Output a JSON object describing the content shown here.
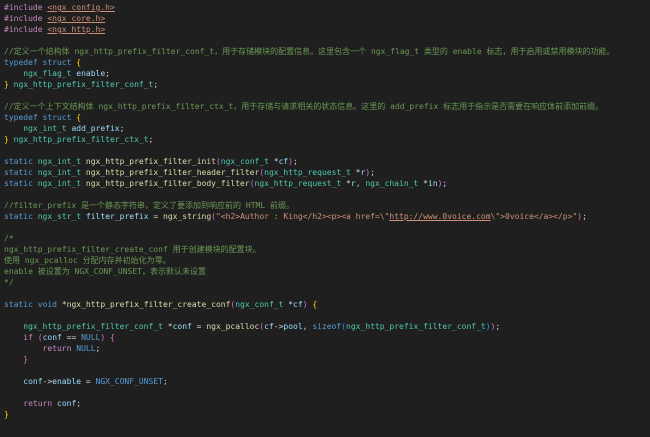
{
  "colors": {
    "background": "#1f1f1f",
    "plain": "#d4d4d4",
    "keyword": "#569cd6",
    "preprocessor": "#c586c0",
    "type": "#4ec9b0",
    "function": "#dcdcaa",
    "variable": "#9cdcfe",
    "string": "#ce9178",
    "comment": "#6a9955",
    "brace": "#ffd700"
  },
  "lines": [
    [
      {
        "t": "#include ",
        "c": "prep"
      },
      {
        "t": "<ngx_config.h>",
        "c": "inc"
      }
    ],
    [
      {
        "t": "#include ",
        "c": "prep"
      },
      {
        "t": "<ngx_core.h>",
        "c": "inc"
      }
    ],
    [
      {
        "t": "#include ",
        "c": "prep"
      },
      {
        "t": "<ngx_http.h>",
        "c": "inc"
      }
    ],
    [],
    [
      {
        "t": "//定义一个结构体 ngx_http_prefix_filter_conf_t，用于存储模块的配置信息。这里包含一个 ngx_flag_t 类型的 enable 标志，用于启用或禁用模块的功能。",
        "c": "comment"
      }
    ],
    [
      {
        "t": "typedef",
        "c": "kw"
      },
      {
        "t": " ",
        "c": "plain"
      },
      {
        "t": "struct",
        "c": "kw"
      },
      {
        "t": " ",
        "c": "plain"
      },
      {
        "t": "{",
        "c": "brace1"
      }
    ],
    [
      {
        "t": "    ",
        "c": "plain"
      },
      {
        "t": "ngx_flag_t",
        "c": "type",
        "s": 1
      },
      {
        "t": " ",
        "c": "plain"
      },
      {
        "t": "enable",
        "c": "var"
      },
      {
        "t": ";",
        "c": "plain"
      }
    ],
    [
      {
        "t": "}",
        "c": "brace1"
      },
      {
        "t": " ",
        "c": "plain"
      },
      {
        "t": "ngx_http_prefix_filter_conf_t",
        "c": "type"
      },
      {
        "t": ";",
        "c": "plain"
      }
    ],
    [],
    [
      {
        "t": "//定义一个上下文结构体 ngx_http_prefix_filter_ctx_t，用于存储与请求相关的状态信息。这里的 add_prefix 标志用于指示是否需要在响应体前添加前缀。",
        "c": "comment"
      }
    ],
    [
      {
        "t": "typedef",
        "c": "kw"
      },
      {
        "t": " ",
        "c": "plain"
      },
      {
        "t": "struct",
        "c": "kw"
      },
      {
        "t": " ",
        "c": "plain"
      },
      {
        "t": "{",
        "c": "brace1"
      }
    ],
    [
      {
        "t": "    ",
        "c": "plain"
      },
      {
        "t": "ngx_int_t",
        "c": "type",
        "s": 1
      },
      {
        "t": " ",
        "c": "plain"
      },
      {
        "t": "add_prefix",
        "c": "var"
      },
      {
        "t": ";",
        "c": "plain"
      }
    ],
    [
      {
        "t": "}",
        "c": "brace1"
      },
      {
        "t": " ",
        "c": "plain"
      },
      {
        "t": "ngx_http_prefix_filter_ctx_t",
        "c": "type"
      },
      {
        "t": ";",
        "c": "plain"
      }
    ],
    [],
    [
      {
        "t": "static",
        "c": "kw"
      },
      {
        "t": " ",
        "c": "plain"
      },
      {
        "t": "ngx_int_t",
        "c": "type",
        "s": 1
      },
      {
        "t": " ",
        "c": "plain"
      },
      {
        "t": "ngx_http_prefix_filter_init",
        "c": "func"
      },
      {
        "t": "(",
        "c": "brace2"
      },
      {
        "t": "ngx_conf_t",
        "c": "type",
        "s": 1
      },
      {
        "t": " *",
        "c": "plain"
      },
      {
        "t": "cf",
        "c": "var"
      },
      {
        "t": ")",
        "c": "brace2"
      },
      {
        "t": ";",
        "c": "plain"
      }
    ],
    [
      {
        "t": "static",
        "c": "kw"
      },
      {
        "t": " ",
        "c": "plain"
      },
      {
        "t": "ngx_int_t",
        "c": "type",
        "s": 1
      },
      {
        "t": " ",
        "c": "plain"
      },
      {
        "t": "ngx_http_prefix_filter_header_filter",
        "c": "func"
      },
      {
        "t": "(",
        "c": "brace2"
      },
      {
        "t": "ngx_http_request_t",
        "c": "type",
        "s": 1
      },
      {
        "t": " *",
        "c": "plain"
      },
      {
        "t": "r",
        "c": "var"
      },
      {
        "t": ")",
        "c": "brace2"
      },
      {
        "t": ";",
        "c": "plain"
      }
    ],
    [
      {
        "t": "static",
        "c": "kw"
      },
      {
        "t": " ",
        "c": "plain"
      },
      {
        "t": "ngx_int_t",
        "c": "type",
        "s": 1
      },
      {
        "t": " ",
        "c": "plain"
      },
      {
        "t": "ngx_http_prefix_filter_body_filter",
        "c": "func"
      },
      {
        "t": "(",
        "c": "brace2"
      },
      {
        "t": "ngx_http_request_t",
        "c": "type",
        "s": 1
      },
      {
        "t": " *",
        "c": "plain"
      },
      {
        "t": "r",
        "c": "var"
      },
      {
        "t": ", ",
        "c": "plain"
      },
      {
        "t": "ngx_chain_t",
        "c": "type",
        "s": 1
      },
      {
        "t": " *",
        "c": "plain"
      },
      {
        "t": "in",
        "c": "var"
      },
      {
        "t": ")",
        "c": "brace2"
      },
      {
        "t": ";",
        "c": "plain"
      }
    ],
    [],
    [
      {
        "t": "//filter_prefix 是一个静态字符串，定义了要添加到响应前的 HTML 前缀。",
        "c": "comment"
      }
    ],
    [
      {
        "t": "static",
        "c": "kw"
      },
      {
        "t": " ",
        "c": "plain"
      },
      {
        "t": "ngx_str_t",
        "c": "type",
        "s": 1
      },
      {
        "t": " ",
        "c": "plain"
      },
      {
        "t": "filter_prefix",
        "c": "var"
      },
      {
        "t": " = ",
        "c": "plain"
      },
      {
        "t": "ngx_string",
        "c": "func",
        "s": 1
      },
      {
        "t": "(",
        "c": "brace2"
      },
      {
        "t": "\"<h2>Author : King</h2><p><a href=\\\"",
        "c": "str"
      },
      {
        "t": "http://www.0voice.com",
        "c": "str",
        "u": 1
      },
      {
        "t": "\\\">0voice</a></p>\"",
        "c": "str"
      },
      {
        "t": ")",
        "c": "brace2"
      },
      {
        "t": ";",
        "c": "plain"
      }
    ],
    [],
    [
      {
        "t": "/*",
        "c": "comment"
      }
    ],
    [
      {
        "t": "ngx_http_prefix_filter_create_conf 用于创建模块的配置块。",
        "c": "comment"
      }
    ],
    [
      {
        "t": "使用 ngx_pcalloc 分配内存并初始化为零。",
        "c": "comment"
      }
    ],
    [
      {
        "t": "enable 被设置为 NGX_CONF_UNSET，表示默认未设置",
        "c": "comment"
      }
    ],
    [
      {
        "t": "*/",
        "c": "comment"
      }
    ],
    [],
    [
      {
        "t": "static",
        "c": "kw"
      },
      {
        "t": " ",
        "c": "plain"
      },
      {
        "t": "void",
        "c": "kw"
      },
      {
        "t": " *",
        "c": "plain"
      },
      {
        "t": "ngx_http_prefix_filter_create_conf",
        "c": "func"
      },
      {
        "t": "(",
        "c": "brace2"
      },
      {
        "t": "ngx_conf_t",
        "c": "type",
        "s": 1
      },
      {
        "t": " *",
        "c": "plain"
      },
      {
        "t": "cf",
        "c": "var"
      },
      {
        "t": ")",
        "c": "brace2"
      },
      {
        "t": " ",
        "c": "plain"
      },
      {
        "t": "{",
        "c": "brace1"
      }
    ],
    [],
    [
      {
        "t": "    ",
        "c": "plain"
      },
      {
        "t": "ngx_http_prefix_filter_conf_t",
        "c": "type"
      },
      {
        "t": " *",
        "c": "plain"
      },
      {
        "t": "conf",
        "c": "var"
      },
      {
        "t": " = ",
        "c": "plain"
      },
      {
        "t": "ngx_pcalloc",
        "c": "func",
        "s": 1
      },
      {
        "t": "(",
        "c": "brace2"
      },
      {
        "t": "cf",
        "c": "var"
      },
      {
        "t": "->",
        "c": "plain"
      },
      {
        "t": "pool",
        "c": "var"
      },
      {
        "t": ", ",
        "c": "plain"
      },
      {
        "t": "sizeof",
        "c": "kw"
      },
      {
        "t": "(",
        "c": "brace3"
      },
      {
        "t": "ngx_http_prefix_filter_conf_t",
        "c": "type"
      },
      {
        "t": ")",
        "c": "brace3"
      },
      {
        "t": ")",
        "c": "brace2"
      },
      {
        "t": ";",
        "c": "plain"
      }
    ],
    [
      {
        "t": "    ",
        "c": "plain"
      },
      {
        "t": "if",
        "c": "kw2"
      },
      {
        "t": " ",
        "c": "plain"
      },
      {
        "t": "(",
        "c": "brace2"
      },
      {
        "t": "conf",
        "c": "var"
      },
      {
        "t": " == ",
        "c": "plain"
      },
      {
        "t": "NULL",
        "c": "macro",
        "s": 1
      },
      {
        "t": ")",
        "c": "brace2"
      },
      {
        "t": " ",
        "c": "plain"
      },
      {
        "t": "{",
        "c": "brace2"
      }
    ],
    [
      {
        "t": "        ",
        "c": "plain"
      },
      {
        "t": "return",
        "c": "kw2"
      },
      {
        "t": " ",
        "c": "plain"
      },
      {
        "t": "NULL",
        "c": "macro",
        "s": 1
      },
      {
        "t": ";",
        "c": "plain"
      }
    ],
    [
      {
        "t": "    ",
        "c": "plain"
      },
      {
        "t": "}",
        "c": "brace2"
      }
    ],
    [],
    [
      {
        "t": "    ",
        "c": "plain"
      },
      {
        "t": "conf",
        "c": "var"
      },
      {
        "t": "->",
        "c": "plain"
      },
      {
        "t": "enable",
        "c": "var"
      },
      {
        "t": " = ",
        "c": "plain"
      },
      {
        "t": "NGX_CONF_UNSET",
        "c": "macro"
      },
      {
        "t": ";",
        "c": "plain"
      }
    ],
    [],
    [
      {
        "t": "    ",
        "c": "plain"
      },
      {
        "t": "return",
        "c": "kw2"
      },
      {
        "t": " ",
        "c": "plain"
      },
      {
        "t": "conf",
        "c": "var"
      },
      {
        "t": ";",
        "c": "plain"
      }
    ],
    [
      {
        "t": "}",
        "c": "brace1"
      }
    ]
  ]
}
